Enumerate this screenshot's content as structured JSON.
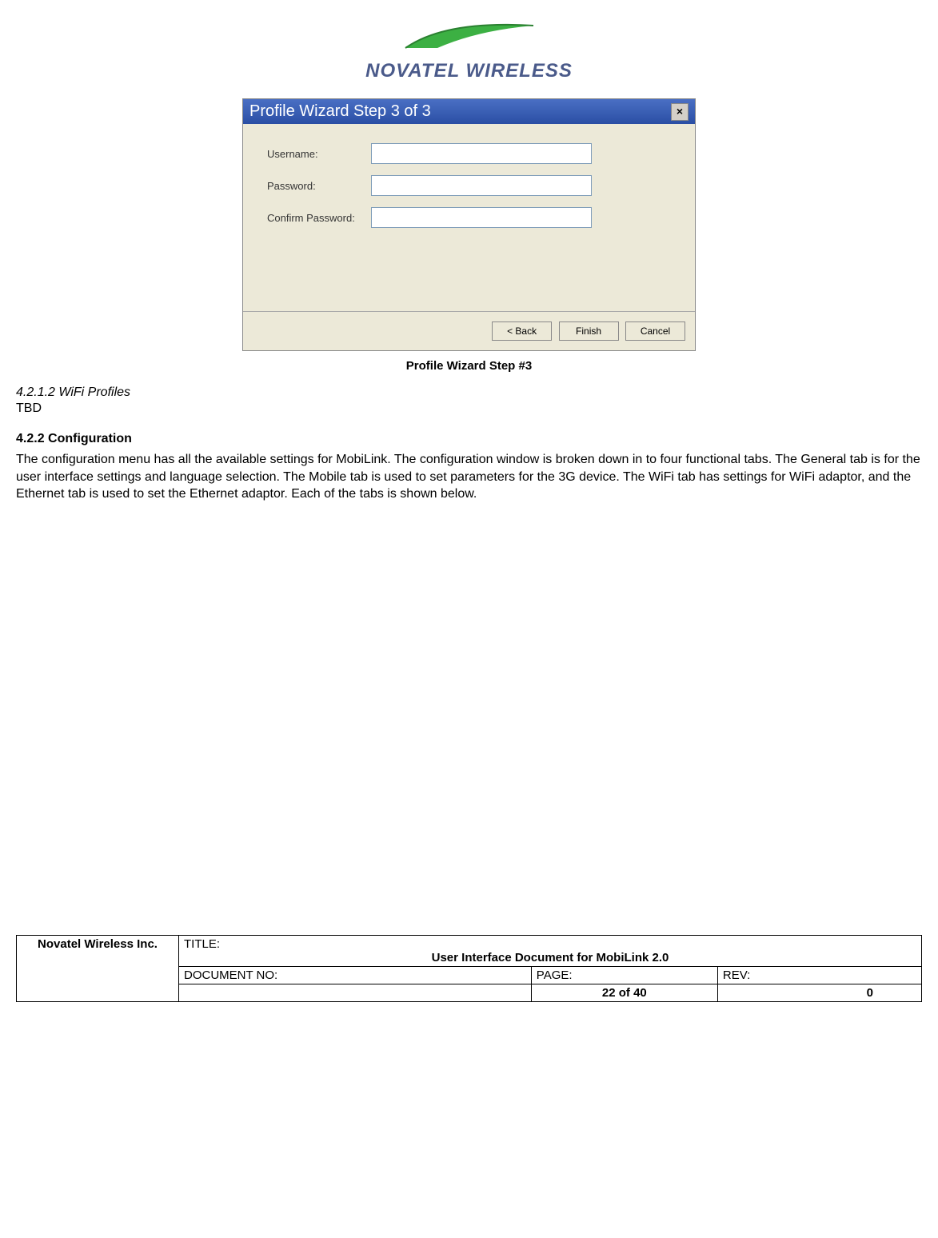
{
  "logo": {
    "brand_text": "NOVATEL WIRELESS"
  },
  "dialog": {
    "title": "Profile Wizard Step 3 of 3",
    "close_label": "×",
    "fields": {
      "username_label": "Username:",
      "username_value": "",
      "password_label": "Password:",
      "password_value": "",
      "confirm_label": "Confirm Password:",
      "confirm_value": ""
    },
    "buttons": {
      "back": "< Back",
      "finish": "Finish",
      "cancel": "Cancel"
    }
  },
  "caption": "Profile Wizard Step #3",
  "section_wifi": {
    "number": "4.2.1.2   WiFi Profiles",
    "body": "TBD"
  },
  "section_config": {
    "number": "4.2.2    Configuration",
    "body": "The configuration menu has all the available settings for MobiLink.  The configuration window is broken down in to four functional tabs.  The General tab is for the user interface settings and language selection.  The Mobile tab is used to set parameters for the 3G device.  The WiFi tab has settings for WiFi adaptor, and the Ethernet tab is used to set the Ethernet adaptor.  Each of the tabs is shown below."
  },
  "footer": {
    "company": "Novatel Wireless Inc.",
    "title_label": "TITLE:",
    "title_value": "User Interface Document for MobiLink 2.0",
    "docno_label": "DOCUMENT NO:",
    "docno_value": "",
    "page_label": "PAGE:",
    "page_value": "22 of 40",
    "rev_label": "REV:",
    "rev_value": "0"
  }
}
